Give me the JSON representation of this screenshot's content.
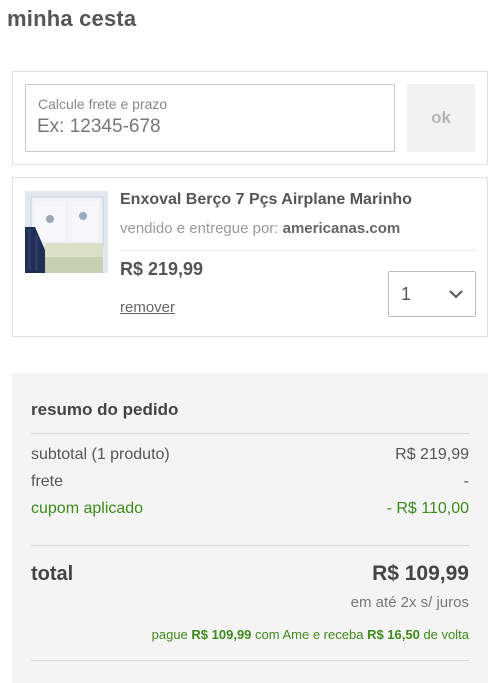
{
  "page": {
    "title": "minha cesta"
  },
  "shipping": {
    "label": "Calcule frete e prazo",
    "placeholder": "Ex: 12345-678",
    "ok_label": "ok"
  },
  "product": {
    "image_icon": "baby-crib-bedding-photo",
    "name": "Enxoval Berço 7 Pçs Airplane Marinho",
    "seller_prefix": "vendido e entregue por:",
    "seller_name": "americanas.com",
    "price": "R$ 219,99",
    "quantity": "1",
    "remove_label": "remover"
  },
  "summary": {
    "title": "resumo do pedido",
    "subtotal_label": "subtotal (1 produto)",
    "subtotal_value": "R$ 219,99",
    "shipping_label": "frete",
    "shipping_value": "-",
    "coupon_label": "cupom aplicado",
    "coupon_value": "- R$ 110,00",
    "total_label": "total",
    "total_value": "R$ 109,99",
    "installments": "em até 2x s/ juros",
    "ame": {
      "t1": "pague",
      "v1": "R$ 109,99",
      "t2": "com Ame e receba",
      "v2": "R$ 16,50",
      "t3": "de volta"
    }
  },
  "colors": {
    "green": "#3f8a1d",
    "summary_bg": "#f4f4f4",
    "border": "#e0e0e0"
  }
}
